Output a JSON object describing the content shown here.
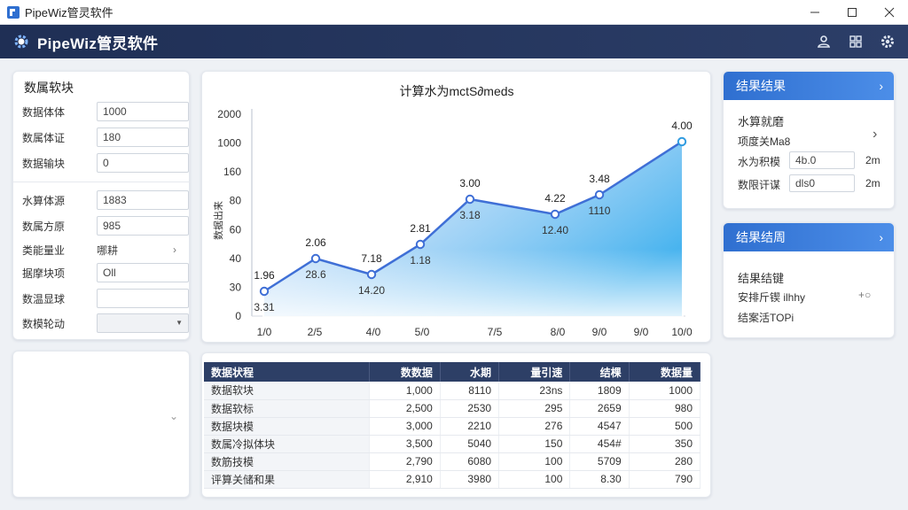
{
  "window": {
    "title": "PipeWiz管灵软件"
  },
  "appbar": {
    "name": "PipeWiz管灵软件"
  },
  "params": {
    "title": "数属软块",
    "rows": [
      {
        "label": "数据体体",
        "value": "1000",
        "kind": "input"
      },
      {
        "label": "数属体证",
        "value": "180",
        "kind": "input"
      },
      {
        "label": "数据输块",
        "value": "0",
        "kind": "input"
      },
      {
        "label": "水算体源",
        "value": "1883",
        "kind": "input"
      },
      {
        "label": "数属方原",
        "value": "985",
        "kind": "input"
      },
      {
        "label": "类能量业",
        "value": "哪耕",
        "kind": "link"
      },
      {
        "label": "据摩块项",
        "value": "Oll",
        "kind": "input"
      },
      {
        "label": "数温显球",
        "value": "",
        "kind": "input"
      },
      {
        "label": "数模轮动",
        "value": "",
        "kind": "select"
      }
    ]
  },
  "chart_data": {
    "type": "area",
    "title": "计算水为mctS∂meds",
    "x_ticks": [
      "1/0",
      "2/5",
      "4/0",
      "5/0",
      "7/5",
      "8/0",
      "9/0",
      "9/0",
      "10/0"
    ],
    "y_ticks": [
      "0",
      "30",
      "40",
      "60",
      "80",
      "160",
      "1000",
      "2000"
    ],
    "ylabel": "数据出来",
    "points": [
      {
        "upper": "1.96",
        "lower": "3.31"
      },
      {
        "upper": "2.06",
        "lower": "28.6"
      },
      {
        "upper": "7.18",
        "lower": "14.20"
      },
      {
        "upper": "2.81",
        "lower": "1.18"
      },
      {
        "upper": "3.00",
        "lower": "3.18"
      },
      {
        "upper": "4.22",
        "lower": "12.40"
      },
      {
        "upper": "3.48",
        "lower": "1110"
      },
      {
        "upper": "4.00",
        "lower": ""
      }
    ],
    "colors": {
      "line": "#3f6fd6",
      "area_top": "#3fb0ee",
      "area_bottom": "#ffffff"
    }
  },
  "table": {
    "headers": [
      "数据状程",
      "数数据",
      "水期",
      "量引速",
      "结棵",
      "数据量"
    ],
    "rows": [
      [
        "数据软块",
        "1,000",
        "8110",
        "23ns",
        "1809",
        "1000"
      ],
      [
        "数据软标",
        "2,500",
        "2530",
        "295",
        "2659",
        "980"
      ],
      [
        "数据块模",
        "3,000",
        "2210",
        "276",
        "4547",
        "500"
      ],
      [
        "数属冷拟体块",
        "3,500",
        "5040",
        "150",
        "454#",
        "350"
      ],
      [
        "数筋技模",
        "2,790",
        "6080",
        "100",
        "5709",
        "280"
      ],
      [
        "评算关储和果",
        "2,910",
        "3980",
        "100",
        "8.30",
        "790"
      ]
    ]
  },
  "result1": {
    "title": "结果结果",
    "line1": "水算就磨",
    "line2": "项度关Ma8",
    "f1_label": "水为积模",
    "f1_value": "4b.0",
    "f1_unit": "2m",
    "f2_label": "数限讦谋",
    "f2_value": "dls0",
    "f2_unit": "2m"
  },
  "result2": {
    "title": "结果结周",
    "line1": "结果结键",
    "line2": "安排斤锲 ilhhy",
    "line3": "结案活TOPi",
    "plus": "+○"
  }
}
